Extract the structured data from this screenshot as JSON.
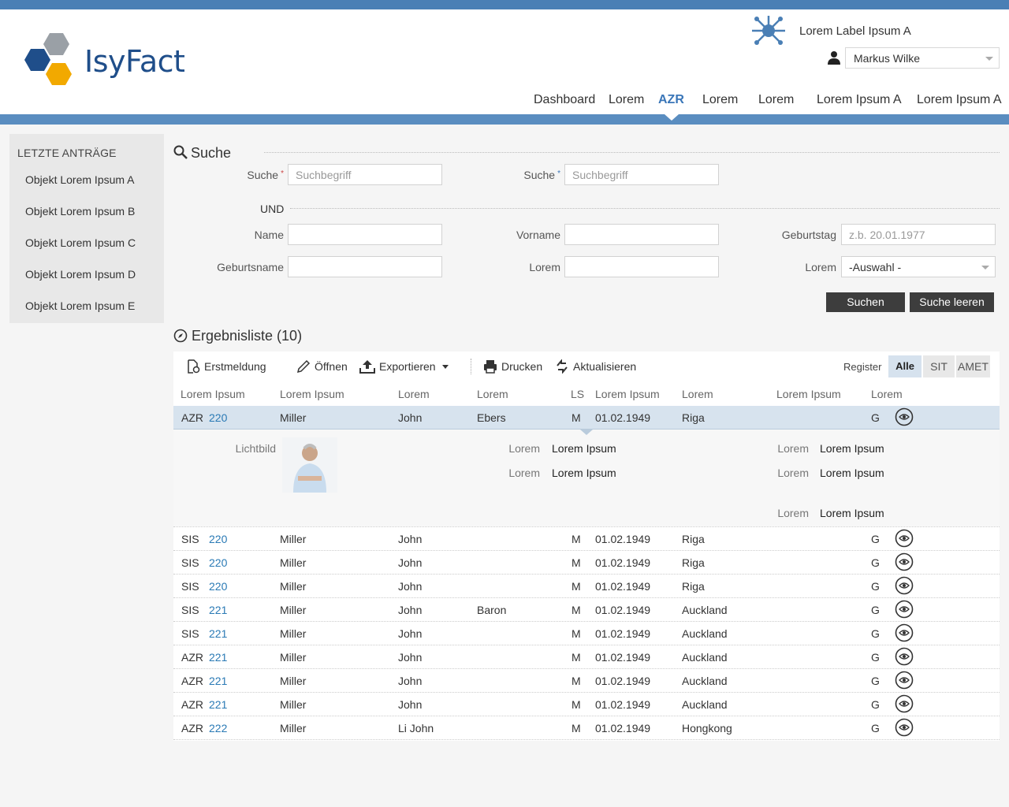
{
  "header": {
    "logo_text": "IsyFact",
    "app_label": "Lorem Label Ipsum A",
    "user": "Markus Wilke"
  },
  "nav": [
    "Dashboard",
    "Lorem",
    "AZR",
    "Lorem",
    "Lorem",
    "Lorem Ipsum A",
    "Lorem Ipsum A"
  ],
  "sidebar": {
    "title": "LETZTE ANTRÄGE",
    "items": [
      "Objekt Lorem Ipsum A",
      "Objekt Lorem Ipsum B",
      "Objekt Lorem Ipsum C",
      "Objekt Lorem Ipsum D",
      "Objekt Lorem Ipsum E"
    ]
  },
  "search": {
    "title": "Suche",
    "label1": "Suche",
    "placeholder1": "Suchbegriff",
    "label2": "Suche",
    "placeholder2": "Suchbegriff",
    "und": "UND",
    "name_label": "Name",
    "vorname_label": "Vorname",
    "geburtstag_label": "Geburtstag",
    "geburtstag_placeholder": "z.b. 20.01.1977",
    "geburtsname_label": "Geburtsname",
    "lorem_label": "Lorem",
    "lorem_select_label": "Lorem",
    "select_value": "-Auswahl -",
    "btn_search": "Suchen",
    "btn_clear": "Suche leeren"
  },
  "results": {
    "title": "Ergebnisliste (10)",
    "toolbar": {
      "erstmeldung": "Erstmeldung",
      "oeffnen": "Öffnen",
      "exportieren": "Exportieren",
      "drucken": "Drucken",
      "aktualisieren": "Aktualisieren"
    },
    "register_label": "Register",
    "register_tabs": [
      "Alle",
      "SIT",
      "AMET"
    ],
    "columns": [
      "Lorem Ipsum",
      "Lorem Ipsum",
      "Lorem",
      "Lorem",
      "LS",
      "Lorem Ipsum",
      "Lorem",
      "Lorem  Ipsum",
      "Lorem"
    ],
    "rows": [
      [
        "AZR",
        "220",
        "Miller",
        "John",
        "Ebers",
        "M",
        "01.02.1949",
        "Riga",
        "G"
      ],
      [
        "SIS",
        "220",
        "Miller",
        "John",
        "",
        "M",
        "01.02.1949",
        "Riga",
        "G"
      ],
      [
        "SIS",
        "220",
        "Miller",
        "John",
        "",
        "M",
        "01.02.1949",
        "Riga",
        "G"
      ],
      [
        "SIS",
        "220",
        "Miller",
        "John",
        "",
        "M",
        "01.02.1949",
        "Riga",
        "G"
      ],
      [
        "SIS",
        "221",
        "Miller",
        "John",
        "Baron",
        "M",
        "01.02.1949",
        "Auckland",
        "G"
      ],
      [
        "SIS",
        "221",
        "Miller",
        "John",
        "",
        "M",
        "01.02.1949",
        "Auckland",
        "G"
      ],
      [
        "AZR",
        "221",
        "Miller",
        "John",
        "",
        "M",
        "01.02.1949",
        "Auckland",
        "G"
      ],
      [
        "AZR",
        "221",
        "Miller",
        "John",
        "",
        "M",
        "01.02.1949",
        "Auckland",
        "G"
      ],
      [
        "AZR",
        "221",
        "Miller",
        "John",
        "",
        "M",
        "01.02.1949",
        "Auckland",
        "G"
      ],
      [
        "AZR",
        "222",
        "Miller",
        "Li John",
        "",
        "M",
        "01.02.1949",
        "Hongkong",
        "G"
      ]
    ],
    "detail": {
      "lichtbild_label": "Lichtbild",
      "fields": [
        {
          "label": "Lorem",
          "value": "Lorem Ipsum"
        },
        {
          "label": "Lorem",
          "value": "Lorem Ipsum"
        },
        {
          "label": "Lorem",
          "value": "Lorem Ipsum"
        },
        {
          "label": "Lorem",
          "value": "Lorem Ipsum"
        },
        {
          "label": "Lorem",
          "value": "Lorem Ipsum"
        }
      ]
    }
  },
  "colors": {
    "brand_blue": "#4a7fb5",
    "nav_active": "#3a76b8",
    "link": "#2a7ab5",
    "selected_row": "#d7e3ee",
    "button_dark": "#3d3d3d"
  }
}
